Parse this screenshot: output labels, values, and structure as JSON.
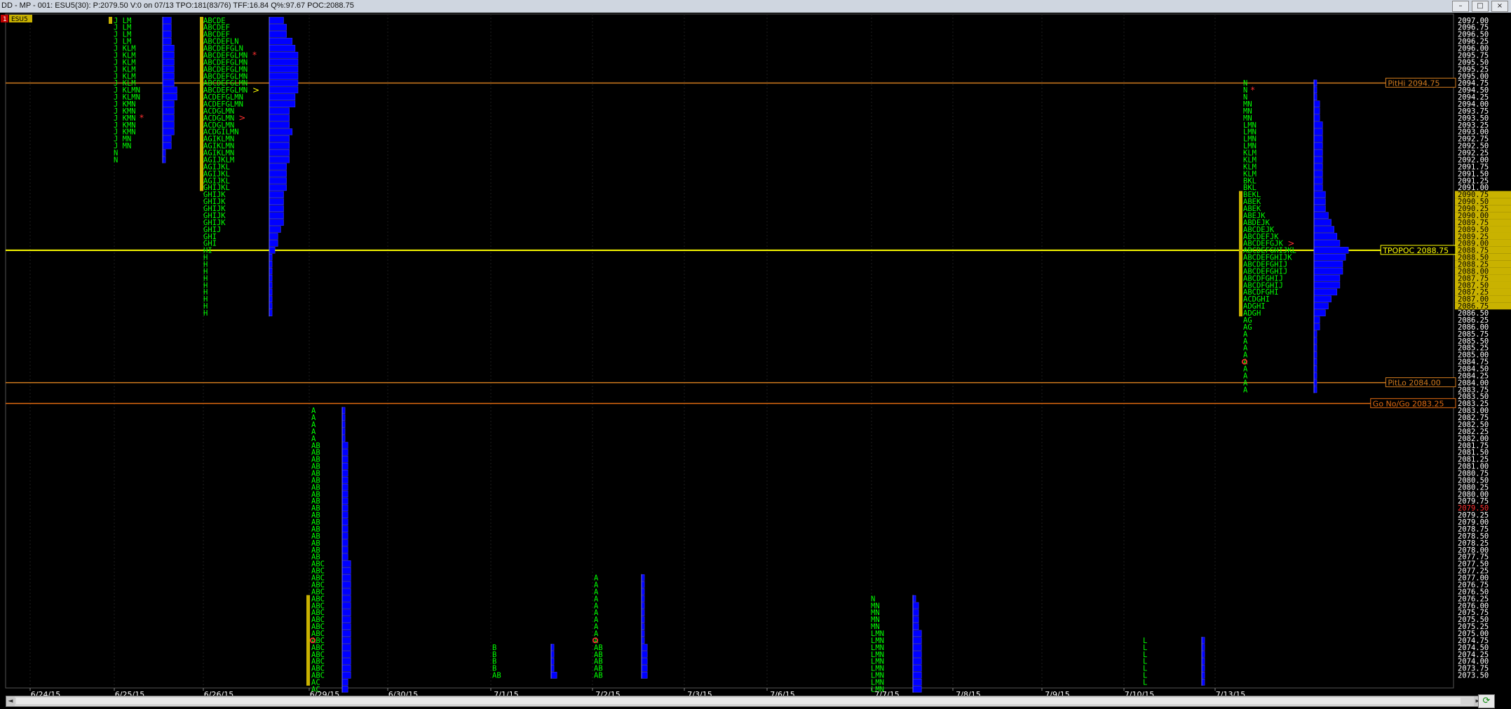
{
  "window": {
    "title": "DD - MP - 001: ESU5(30): P:2079.50 V:0 on 07/13 TPO:181(83/76)  TFF:16.84 Q%:97.67 POC:2088.75",
    "badge_number": "1",
    "symbol_badge": "ESU5",
    "minimize": "–",
    "maximize": "□",
    "close": "×"
  },
  "colors": {
    "background": "#000000",
    "tpo_letters": "#00ff00",
    "histogram": "#0000ff",
    "value_area_bar": "#c9b200",
    "poc_line": "#ffff00",
    "reference_lines": "#d07a1e",
    "current_price": "#ff3030",
    "axis_text": "#ffffff"
  },
  "scroll_left": "◄",
  "scroll_right": "►",
  "refresh_icon": "⟳",
  "chart_data": {
    "type": "market_profile",
    "price_axis": {
      "min": 2073.5,
      "max": 2097.0,
      "tick": 0.25
    },
    "dates": [
      "6/24/15",
      "6/25/15",
      "6/26/15",
      "6/29/15",
      "6/30/15",
      "7/1/15",
      "7/2/15",
      "7/3/15",
      "7/6/15",
      "7/7/15",
      "7/8/15",
      "7/9/15",
      "7/10/15",
      "7/13/15"
    ],
    "current_price": 2079.5,
    "reference_lines": [
      {
        "label": "PitHi 2094.75",
        "price": 2094.75,
        "color": "#d07a1e"
      },
      {
        "label": "TPOPOC 2088.75",
        "price": 2088.75,
        "color": "#ffff00"
      },
      {
        "label": "PitLo 2084.00",
        "price": 2084.0,
        "color": "#d07a1e"
      },
      {
        "label": "Go No/Go 2083.25",
        "price": 2083.25,
        "color": "#e06a10"
      }
    ],
    "highlighted_prices": [
      2090.75,
      2090.5,
      2090.25,
      2090.0,
      2089.75,
      2089.5,
      2089.25,
      2089.0,
      2088.75,
      2088.5,
      2088.25,
      2088.0,
      2087.75,
      2087.5,
      2087.25,
      2087.0,
      2086.75
    ],
    "profiles": [
      {
        "date": "6/25/15",
        "top": 2097.0,
        "tpo": [
          "J LM",
          "J LM",
          "J LM",
          "J LM",
          "J KLM",
          "J KLM",
          "J KLM",
          "J KLM",
          "J KLM",
          "J KLM",
          "J KLMN",
          "J KLMN",
          "J KMN",
          "J KMN",
          "J KMN",
          "J KMN",
          "J KMN",
          "J MN",
          "J MN",
          "N",
          "N"
        ],
        "marks": [
          {
            "row": 14,
            "sym": "*",
            "color": "#ff3030"
          }
        ],
        "va_rows": [
          0,
          0
        ]
      },
      {
        "date": "6/26/15",
        "top": 2097.0,
        "tpo": [
          "ABCDE",
          "ABCDEF",
          "ABCDEF",
          "ABCDEFLN",
          "ABCDEFGLN",
          "ABCDEFGLMN",
          "ABCDEFGLMN",
          "ABCDEFGLMN",
          "ABCDEFGLMN",
          "ABCDEFGLMN",
          "ABCDEFGLMN",
          "ACDEFGLMN",
          "ACDEFGLMN",
          "ACDGLMN",
          "ACDGLMN",
          "ACDGLMN",
          "ACDGILMN",
          "AGIKLMN",
          "AGIKLMN",
          "AGIKLMN",
          "AGIJKLM",
          "AGIJKL",
          "AGIJKL",
          "AGIJKL",
          "GHIJKL",
          "GHIJK",
          "GHIJK",
          "GHIJK",
          "GHIJK",
          "GHIJK",
          "GHIJ",
          "GHI",
          "GHI",
          "HI",
          "H",
          "H",
          "H",
          "H",
          "H",
          "H",
          "H",
          "H",
          "H"
        ],
        "marks": [
          {
            "row": 5,
            "sym": "*",
            "color": "#ff3030"
          },
          {
            "row": 10,
            "sym": ">",
            "color": "#ffff00"
          },
          {
            "row": 14,
            "sym": ">",
            "color": "#ff3030"
          }
        ],
        "va_rows": [
          0,
          24
        ]
      },
      {
        "date": "6/29/15",
        "top": 2083.0,
        "tpo": [
          "A",
          "A",
          "A",
          "A",
          "A",
          "AB",
          "AB",
          "AB",
          "AB",
          "AB",
          "AB",
          "AB",
          "AB",
          "AB",
          "AB",
          "AB",
          "AB",
          "AB",
          "AB",
          "AB",
          "AB",
          "AB",
          "ABC",
          "ABC",
          "ABC",
          "ABC",
          "ABC",
          "ABC",
          "ABC",
          "ABC",
          "ABC",
          "ABC",
          "ABC",
          "ABC",
          "ABC",
          "ABC",
          "ABC",
          "ABC",
          "ABC",
          "AC",
          "AC"
        ],
        "marks": [
          {
            "row": 33,
            "sym": "o",
            "color": "#ff3030"
          }
        ],
        "va_rows": [
          27,
          39
        ]
      },
      {
        "date": "7/1/15",
        "top": 2074.5,
        "tpo": [
          "B",
          "B",
          "B",
          "B",
          "AB"
        ],
        "marks": [],
        "va_rows": null
      },
      {
        "date": "7/2/15",
        "top": 2077.0,
        "tpo": [
          "A",
          "A",
          "A",
          "A",
          "A",
          "A",
          "A",
          "A",
          "A",
          "A",
          "AB",
          "AB",
          "AB",
          "AB",
          "AB"
        ],
        "marks": [
          {
            "row": 9,
            "sym": "o",
            "color": "#ff3030"
          }
        ],
        "va_rows": null
      },
      {
        "date": "7/7/15",
        "top": 2076.25,
        "tpo": [
          "N",
          "MN",
          "MN",
          "MN",
          "MN",
          "LMN",
          "LMN",
          "LMN",
          "LMN",
          "LMN",
          "LMN",
          "LMN",
          "LMN",
          "LMN"
        ],
        "marks": [],
        "va_rows": null
      },
      {
        "date": "7/10/15",
        "top": 2074.75,
        "tpo": [
          "L",
          "L",
          "L",
          "L",
          "L",
          "L",
          "L"
        ],
        "marks": [],
        "va_rows": null
      },
      {
        "date": "7/13/15",
        "top": 2094.75,
        "tpo": [
          "N",
          "N",
          "N",
          "MN",
          "MN",
          "MN",
          "LMN",
          "LMN",
          "LMN",
          "LMN",
          "KLM",
          "KLM",
          "KLM",
          "KLM",
          "BKL",
          "BKL",
          "BEKL",
          "ABEK",
          "ABEK",
          "ABEJK",
          "ABDEJK",
          "ABCDEJK",
          "ABCDEFJK",
          "ABCDEFGJK",
          "ABCDEFGHIJKL",
          "ABCDEFGHIJK",
          "ABCDEFGHIJ",
          "ABCDEFGHIJ",
          "ABCDFGHIJ",
          "ABCDFGHIJ",
          "ABCDFGHI",
          "ACDGHI",
          "ADGHI",
          "ADGH",
          "AG",
          "AG",
          "A",
          "A",
          "A",
          "A",
          "A",
          "A",
          "A",
          "A",
          "A"
        ],
        "marks": [
          {
            "row": 1,
            "sym": "*",
            "color": "#ff3030"
          },
          {
            "row": 23,
            "sym": ">",
            "color": "#ff3030"
          },
          {
            "row": 40,
            "sym": "o",
            "color": "#ff3030"
          }
        ],
        "va_rows": [
          16,
          33
        ]
      }
    ]
  }
}
